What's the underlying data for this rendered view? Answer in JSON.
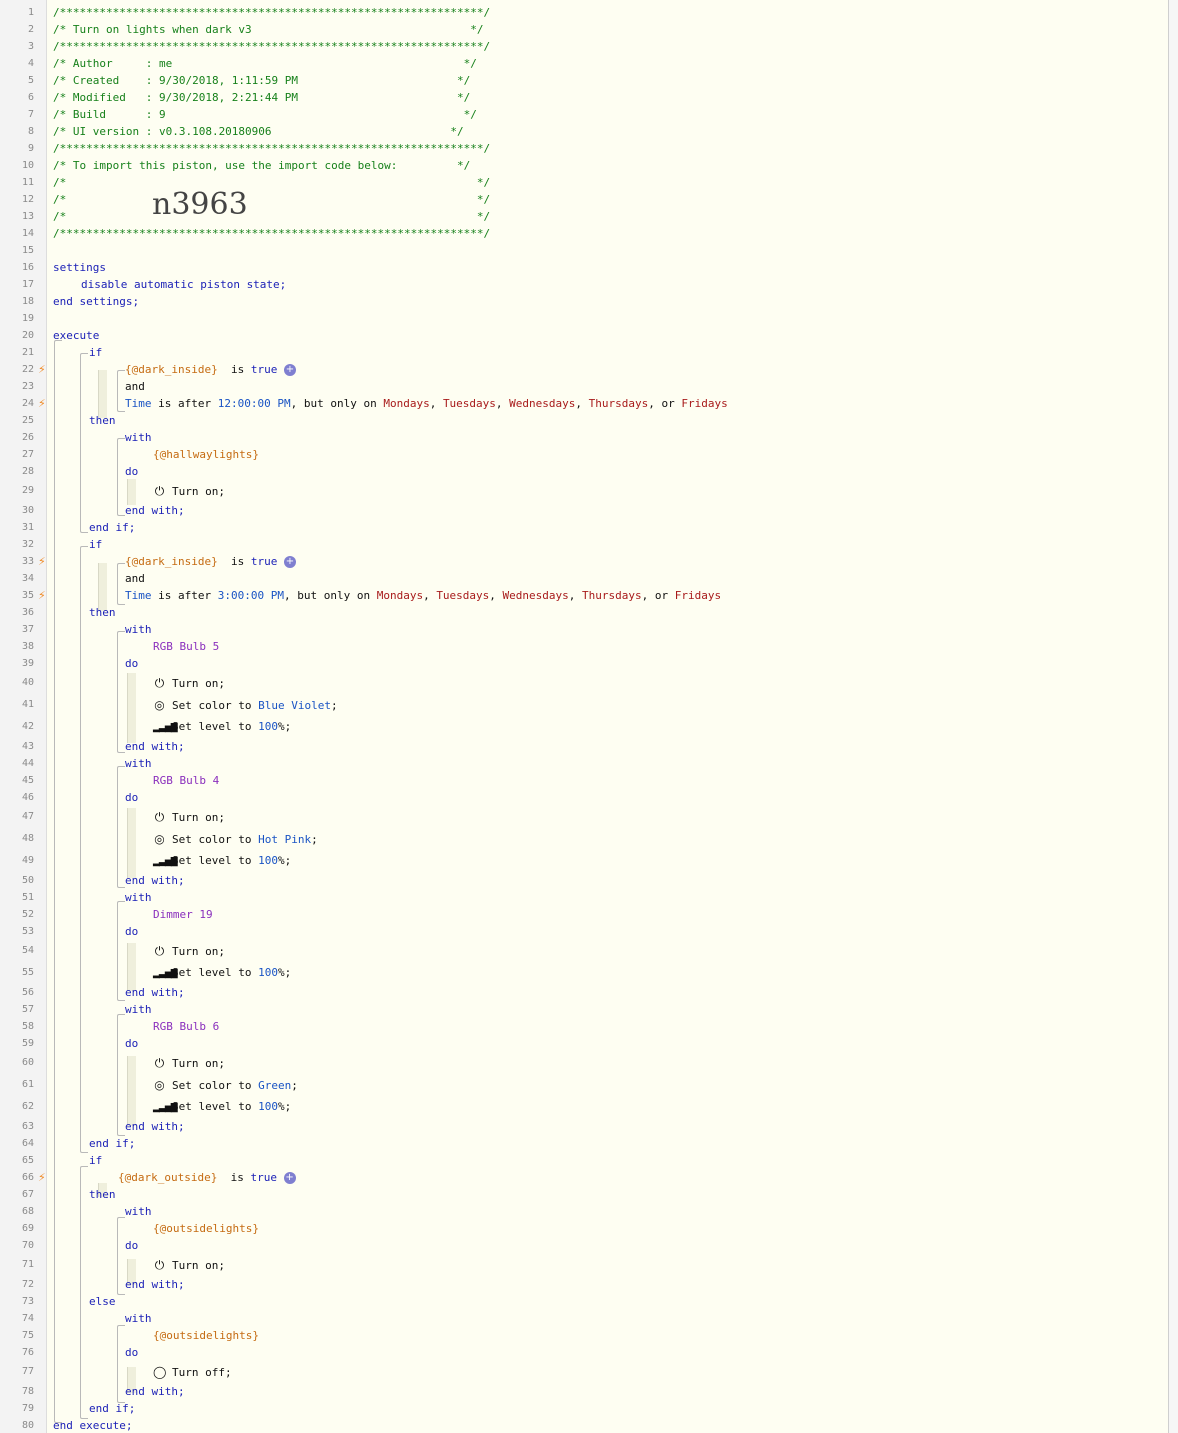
{
  "header": {
    "border": "/****************************************************************/",
    "title": "/* Turn on lights when dark v3                                 */",
    "author": "/* Author     : me                                            */",
    "created": "/* Created    : 9/30/2018, 1:11:59 PM                        */",
    "modified": "/* Modified   : 9/30/2018, 2:21:44 PM                        */",
    "build": "/* Build      : 9                                             */",
    "ui_version": "/* UI version : v0.3.108.20180906                           */",
    "import_note": "/* To import this piston, use the import code below:         */",
    "blank": "/*                                                              */",
    "import_code": "n3963"
  },
  "kw": {
    "settings": "settings",
    "end_settings": "end settings;",
    "execute": "execute",
    "end_execute": "end execute;",
    "if": "if",
    "then": "then",
    "else": "else",
    "end_if": "end if;",
    "with": "with",
    "do": "do",
    "end_with": "end with;",
    "and": "and",
    "is": "is",
    "true": "true",
    "is_after": "is after",
    "but_only_on": "but only on",
    "or": "or",
    "time": "Time",
    "turn_on": "Turn on;",
    "turn_off": "Turn off;",
    "set_color_to": "Set color to",
    "set_level_to": "Set level to",
    "comma": ",",
    "semicolon": ";",
    "percent": "%;",
    "plus": "+"
  },
  "settings_line": "disable automatic piston state;",
  "vars": {
    "dark_inside": "{@dark_inside}",
    "dark_outside": "{@dark_outside}",
    "hallwaylights": "{@hallwaylights}",
    "outsidelights": "{@outsidelights}"
  },
  "devices": {
    "rgb5": "RGB Bulb 5",
    "rgb4": "RGB Bulb 4",
    "dimmer19": "Dimmer 19",
    "rgb6": "RGB Bulb 6"
  },
  "times": {
    "t1": "12:00:00 PM",
    "t2": "3:00:00 PM"
  },
  "days": [
    "Mondays",
    "Tuesdays",
    "Wednesdays",
    "Thursdays",
    "Fridays"
  ],
  "colors": {
    "blue_violet": "Blue Violet",
    "hot_pink": "Hot Pink",
    "green": "Green"
  },
  "levels": {
    "full": "100"
  },
  "icons": {
    "trigger": "lightning-bolt-icon",
    "power": "power-icon",
    "palette": "palette-icon",
    "signal": "signal-bars-icon",
    "power_off": "power-off-icon"
  }
}
